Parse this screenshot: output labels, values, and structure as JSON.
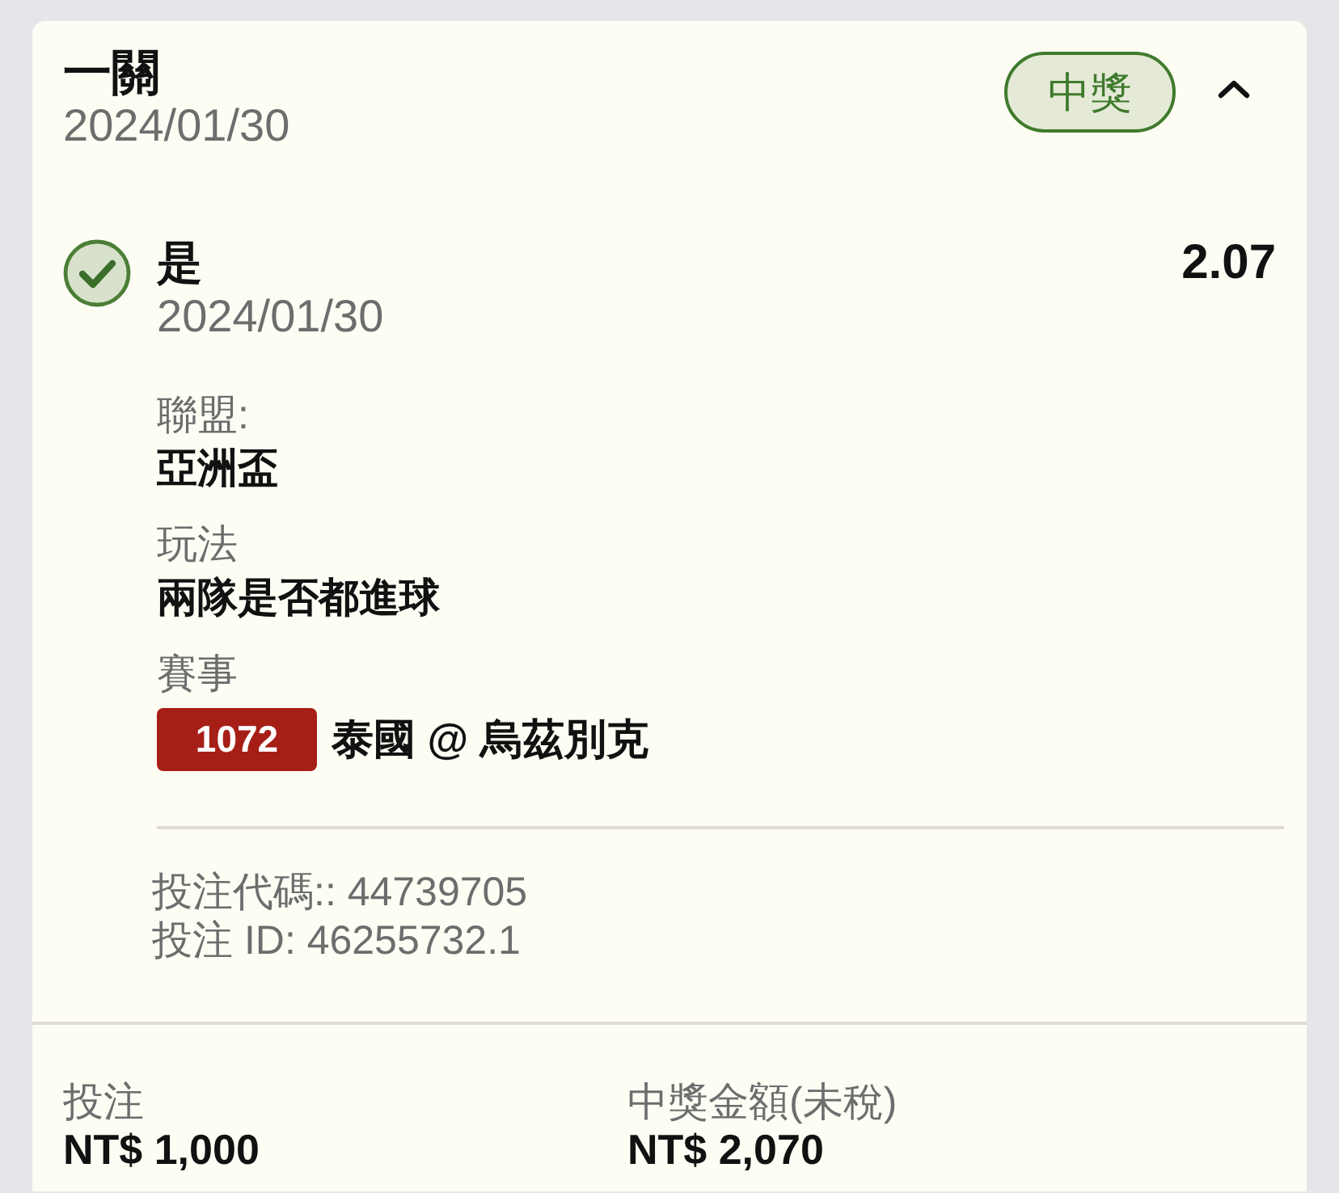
{
  "ticket": {
    "title": "一關",
    "date": "2024/01/30",
    "status": {
      "label": "中獎",
      "kind": "won"
    },
    "expanded": true
  },
  "selections": [
    {
      "won": true,
      "pick": "是",
      "date": "2024/01/30",
      "odds": "2.07",
      "details": [
        {
          "kind": "text",
          "label": "聯盟:",
          "value": "亞洲盃"
        },
        {
          "kind": "text",
          "label": "玩法",
          "value": "兩隊是否都進球"
        },
        {
          "kind": "event",
          "label": "賽事",
          "code": "1072",
          "value": "泰國 @ 烏茲別克"
        }
      ],
      "refs": [
        "投注代碼:: 44739705",
        "投注 ID: 46255732.1"
      ]
    }
  ],
  "summary": [
    {
      "label": "投注",
      "value": "NT$ 1,000"
    },
    {
      "label": "中獎金額(未稅)",
      "value": "NT$ 2,070"
    }
  ]
}
